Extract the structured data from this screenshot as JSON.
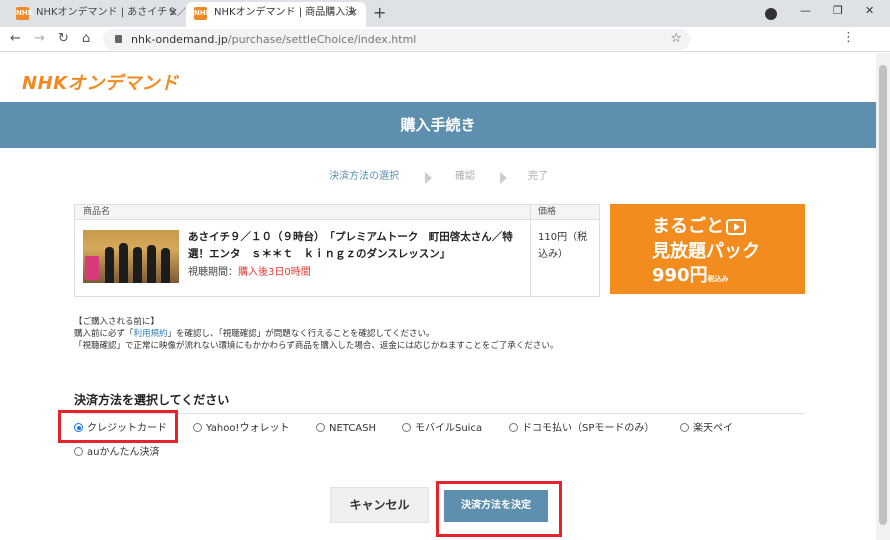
{
  "browser": {
    "tabs": [
      {
        "title": "NHKオンデマンド | あさイチ９／",
        "favicon": "NHK",
        "active": false
      },
      {
        "title": "NHKオンデマンド | 商品購入決",
        "favicon": "NHK",
        "active": true
      }
    ],
    "url_domain": "nhk-ondemand.jp",
    "url_path": "/purchase/settleChoice/index.html"
  },
  "header": {
    "logo": "NHKオンデマンド"
  },
  "page": {
    "title": "購入手続き",
    "steps": [
      "決済方法の選択",
      "確認",
      "完了"
    ]
  },
  "product": {
    "head_name": "商品名",
    "head_price": "価格",
    "title": "あさイチ９／１０（９時台）　「プレミアムトーク　町田啓太さん／特選！エンタ　ｓ＊＊ｔ　ｋｉｎｇｚのダンスレッスン」",
    "period_label": "視聴期間：",
    "period_value": "購入後3日0時間",
    "price": "110円（税込み）"
  },
  "banner": {
    "line1": "まるごと",
    "line2": "見放題パック",
    "line3": "990円",
    "tax_note": "税込み"
  },
  "notice": {
    "heading": "【ご購入される前に】",
    "line1_a": "購入前に必ず「",
    "line1_link": "利用規約",
    "line1_b": "」を確認し、「視聴確認」が問題なく行えることを確認してください。",
    "line2": "「視聴確認」で正常に映像が流れない環境にもかかわらず商品を購入した場合、返金には応じかねますことをご了承ください。"
  },
  "payment": {
    "heading": "決済方法を選択してください",
    "options": [
      {
        "label": "クレジットカード",
        "checked": true
      },
      {
        "label": "Yahoo!ウォレット",
        "checked": false
      },
      {
        "label": "NETCASH",
        "checked": false
      },
      {
        "label": "モバイルSuica",
        "checked": false
      },
      {
        "label": "ドコモ払い（SPモードのみ）",
        "checked": false
      },
      {
        "label": "楽天ペイ",
        "checked": false
      },
      {
        "label": "auかんたん決済",
        "checked": false
      }
    ]
  },
  "actions": {
    "cancel": "キャンセル",
    "decide": "決済方法を決定"
  },
  "colors": {
    "brand_orange": "#f08a24",
    "band_blue": "#5e8fae",
    "highlight_red": "#e5232b"
  }
}
